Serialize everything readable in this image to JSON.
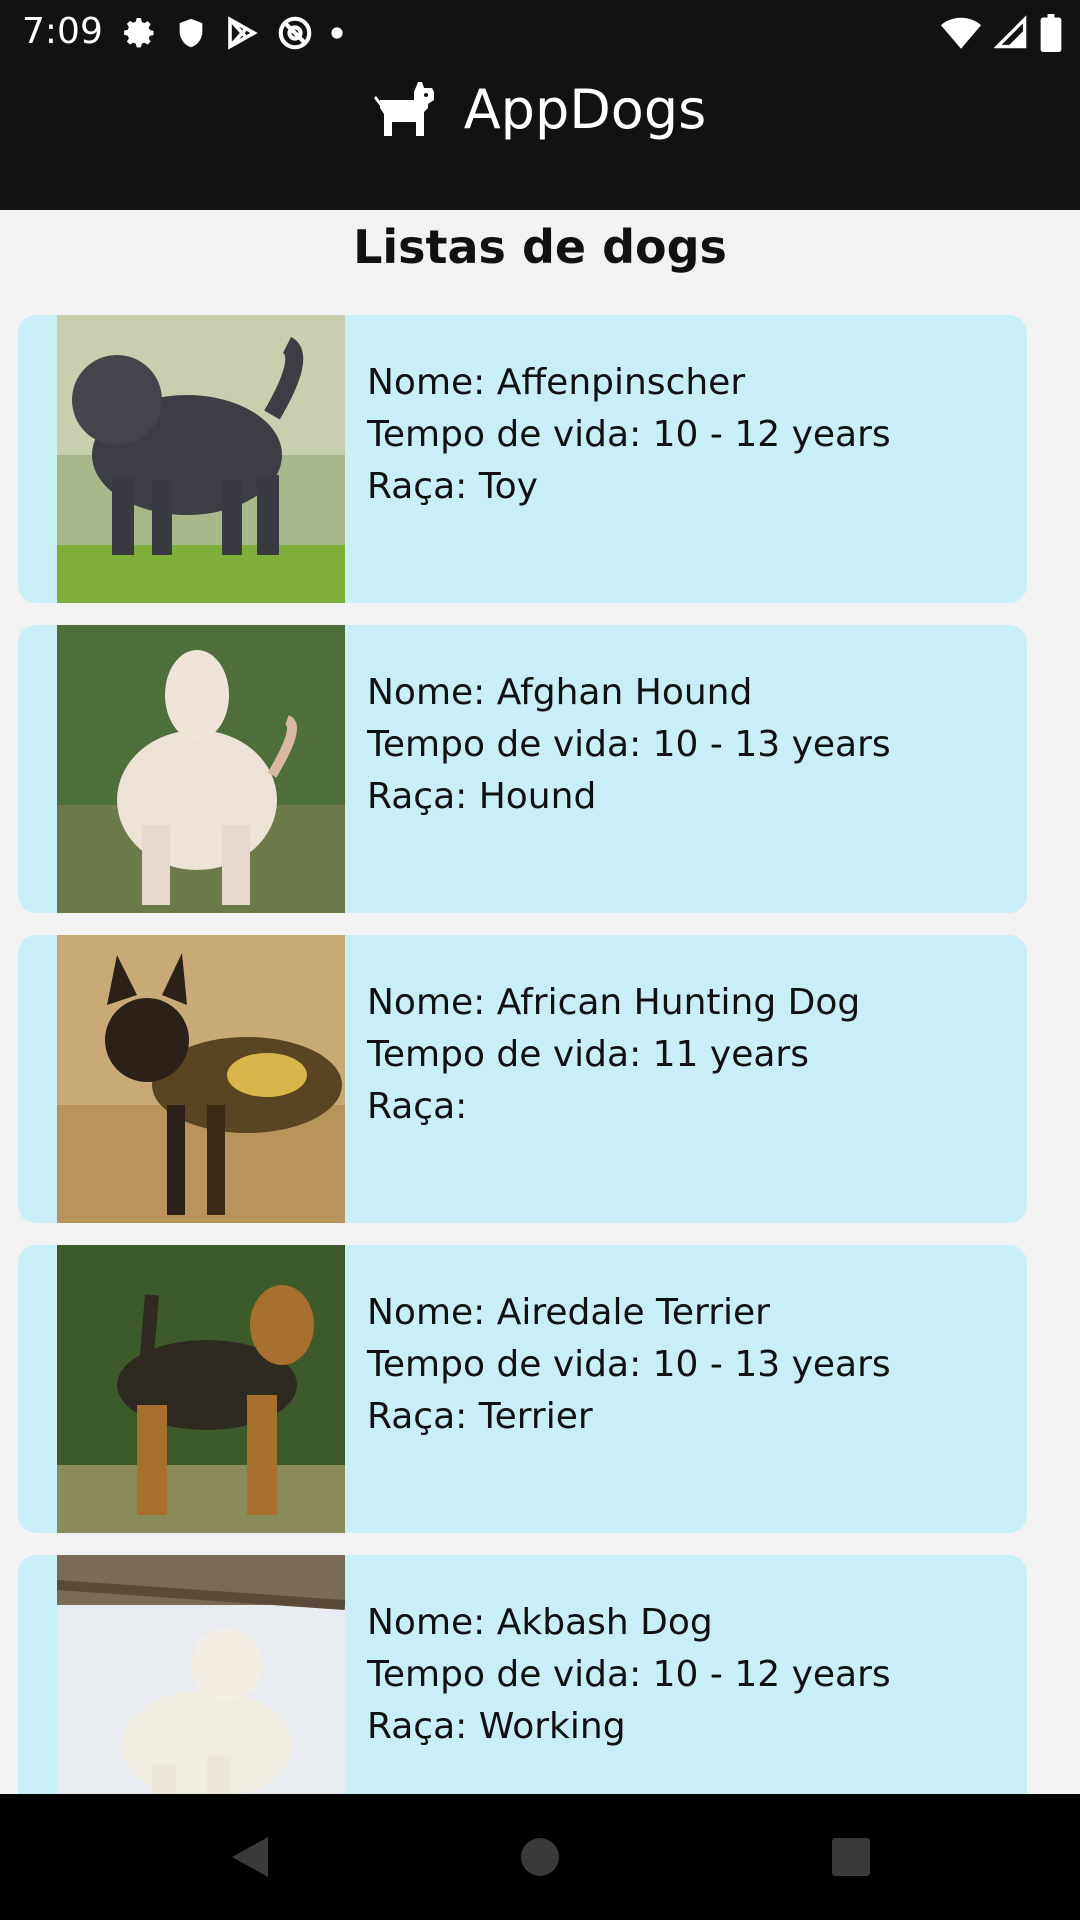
{
  "status_bar": {
    "time": "7:09",
    "left_icons": [
      "gear-icon",
      "shield-icon",
      "play-store-icon",
      "at-sign-icon",
      "dot-icon"
    ],
    "right_icons": [
      "wifi-icon",
      "cell-signal-icon",
      "battery-icon"
    ]
  },
  "app_bar": {
    "title": "AppDogs",
    "icon": "dog-icon"
  },
  "page": {
    "title": "Listas de dogs"
  },
  "dogs": [
    {
      "name": "Nome: Affenpinscher",
      "life": "Tempo de vida: 10 - 12 years",
      "group": "Raça: Toy"
    },
    {
      "name": "Nome: Afghan Hound",
      "life": "Tempo de vida: 10 - 13 years",
      "group": "Raça: Hound"
    },
    {
      "name": "Nome: African Hunting Dog",
      "life": "Tempo de vida: 11 years",
      "group": "Raça:"
    },
    {
      "name": "Nome: Airedale Terrier",
      "life": "Tempo de vida: 10 - 13 years",
      "group": "Raça: Terrier"
    },
    {
      "name": "Nome: Akbash Dog",
      "life": "Tempo de vida: 10 - 12 years",
      "group": "Raça: Working"
    }
  ],
  "colors": {
    "app_bar": "#121212",
    "card": "#c8eef6",
    "background": "#f2f2f2"
  },
  "nav_bar": {
    "buttons": [
      "back-icon",
      "home-icon",
      "recents-icon"
    ]
  }
}
